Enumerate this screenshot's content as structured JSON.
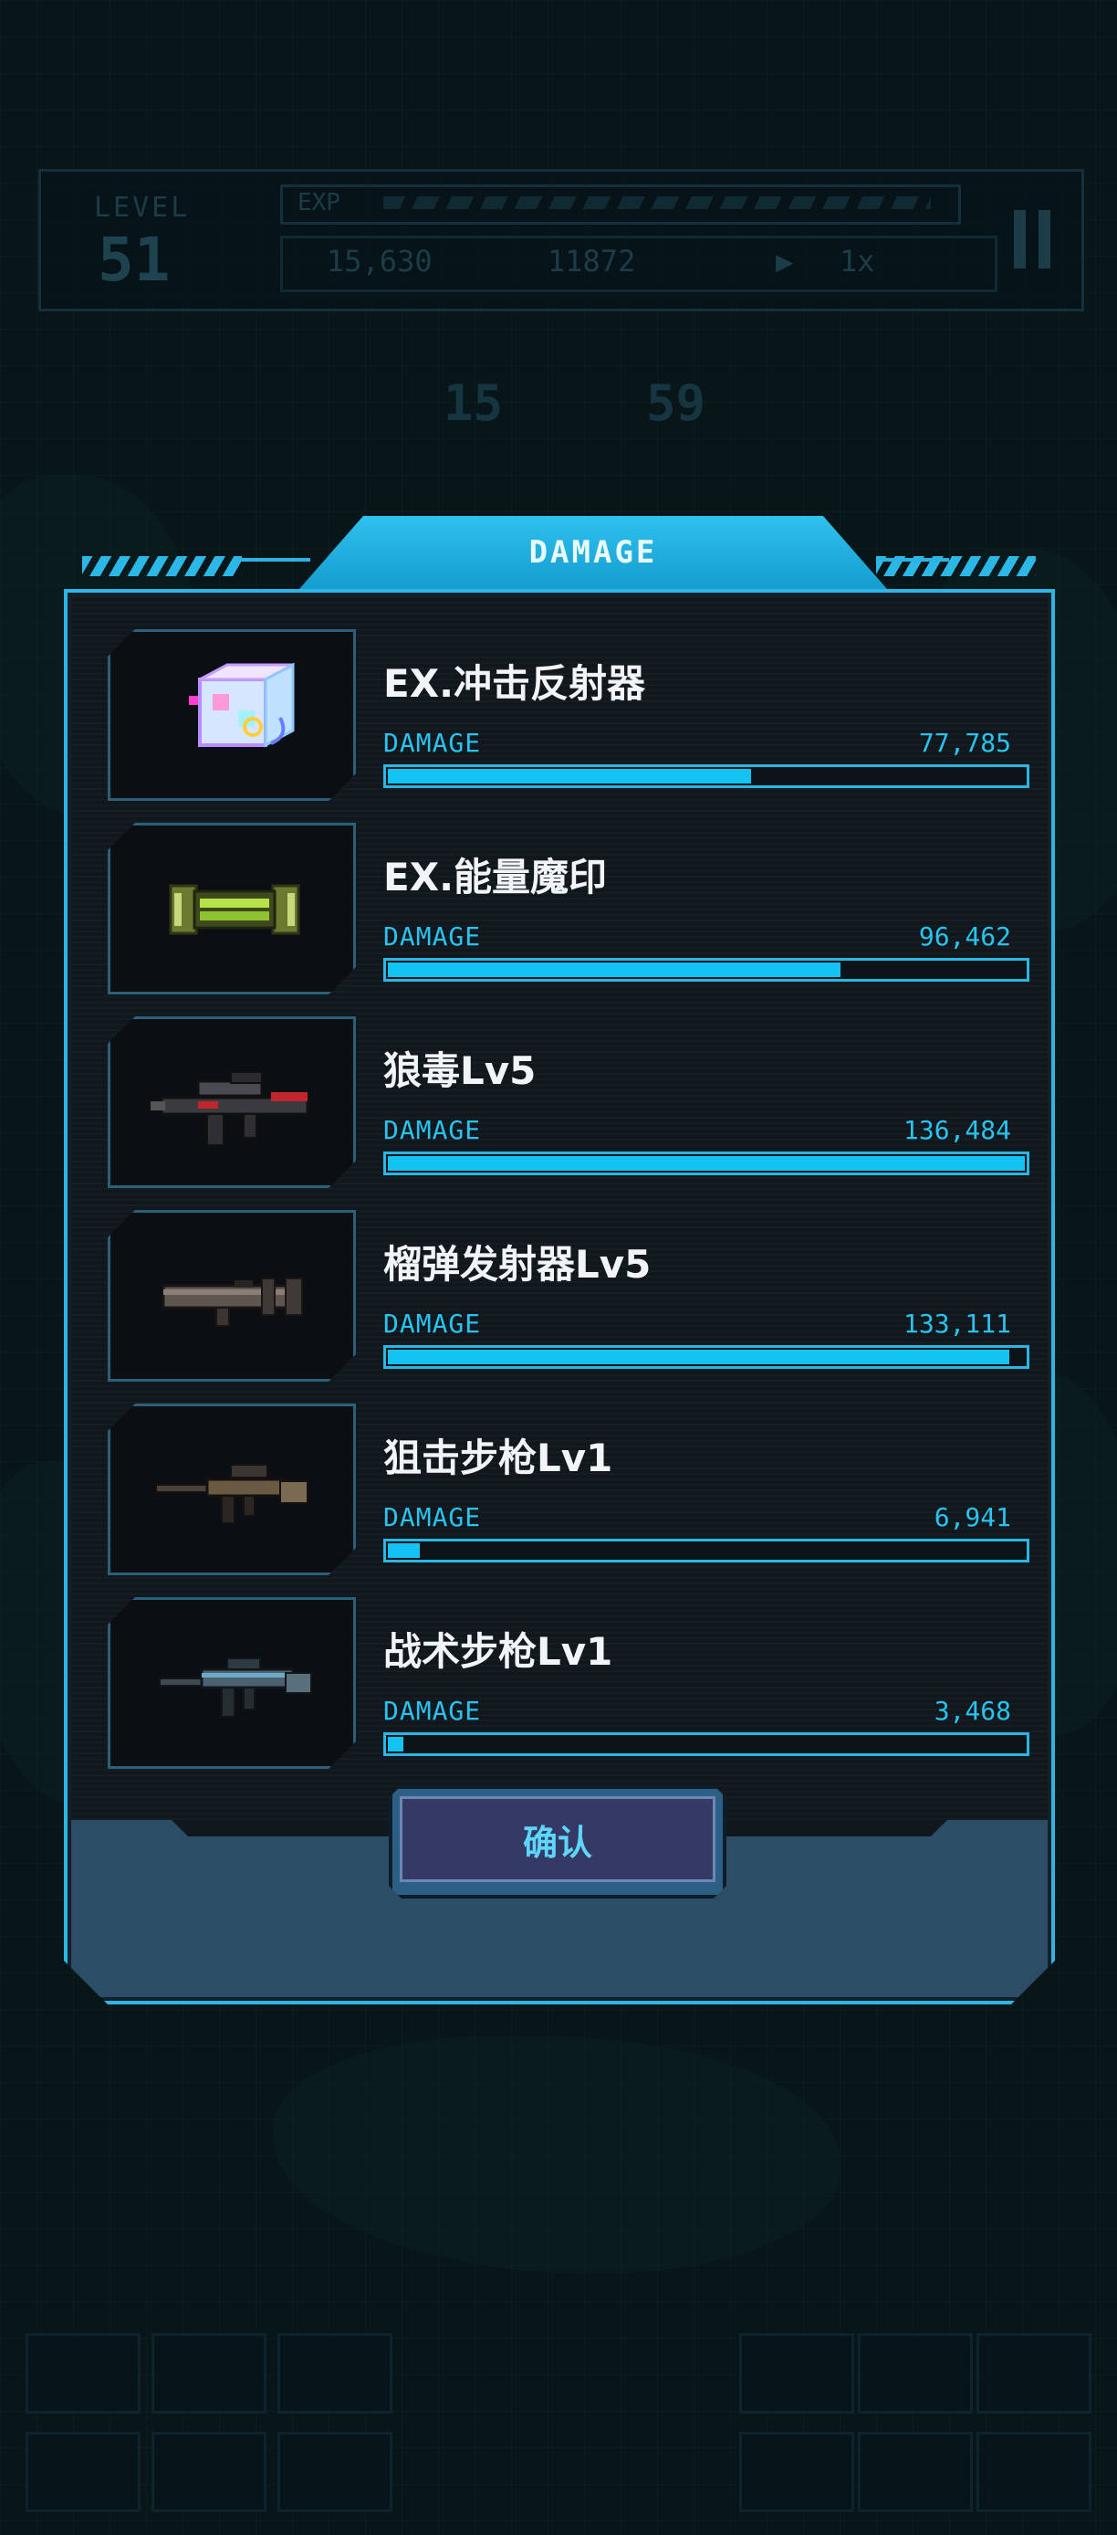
{
  "hud": {
    "level_label": "LEVEL",
    "level_value": "51",
    "exp_label": "EXP",
    "coins": "15,630",
    "kills": "11872",
    "speed": "1x",
    "timer_min": "15",
    "timer_sec": "59"
  },
  "dialog": {
    "title": "DAMAGE",
    "confirm_label": "确认",
    "items": [
      {
        "name": "EX.冲击反射器",
        "damage_label": "DAMAGE",
        "damage": "77,785",
        "ratio": 0.57,
        "icon": "cube-reflector-icon"
      },
      {
        "name": "EX.能量魔印",
        "damage_label": "DAMAGE",
        "damage": "96,462",
        "ratio": 0.71,
        "icon": "energy-canister-icon"
      },
      {
        "name": "狼毒Lv5",
        "damage_label": "DAMAGE",
        "damage": "136,484",
        "ratio": 1.0,
        "icon": "assault-gun-icon"
      },
      {
        "name": "榴弹发射器Lv5",
        "damage_label": "DAMAGE",
        "damage": "133,111",
        "ratio": 0.975,
        "icon": "grenade-launcher-icon"
      },
      {
        "name": "狙击步枪Lv1",
        "damage_label": "DAMAGE",
        "damage": "6,941",
        "ratio": 0.05,
        "icon": "sniper-rifle-icon"
      },
      {
        "name": "战术步枪Lv1",
        "damage_label": "DAMAGE",
        "damage": "3,468",
        "ratio": 0.025,
        "icon": "tactical-rifle-icon"
      }
    ]
  },
  "colors": {
    "accent": "#12c3f3",
    "panel": "#142029",
    "button": "#343a64"
  }
}
